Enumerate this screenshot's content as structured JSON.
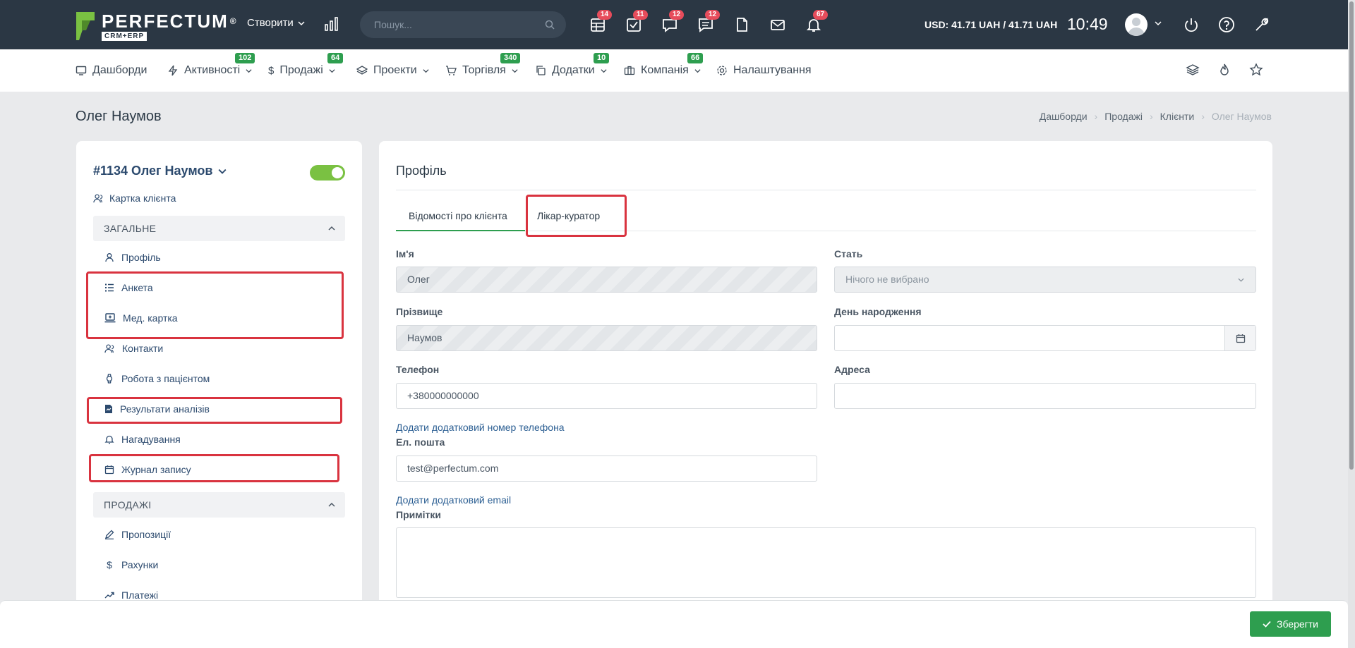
{
  "topbar": {
    "logo_name": "PERFECTUM",
    "logo_reg": "®",
    "logo_sub": "CRM+ERP",
    "create_label": "Створити",
    "search_placeholder": "Пошук...",
    "badges": {
      "calendar": "14",
      "tasks": "11",
      "chat": "12",
      "messages": "12",
      "notifications": "67"
    },
    "rate": "USD: 41.71 UAH / 41.71 UAH",
    "clock": "10:49"
  },
  "nav": {
    "items": [
      {
        "label": "Дашборди",
        "badge": ""
      },
      {
        "label": "Активності",
        "badge": "102"
      },
      {
        "label": "Продажі",
        "badge": "64"
      },
      {
        "label": "Проекти",
        "badge": ""
      },
      {
        "label": "Торгівля",
        "badge": "340"
      },
      {
        "label": "Додатки",
        "badge": "10"
      },
      {
        "label": "Компанія",
        "badge": "66"
      },
      {
        "label": "Налаштування",
        "badge": ""
      }
    ]
  },
  "page": {
    "title": "Олег Наумов",
    "breadcrumb": [
      "Дашборди",
      "Продажі",
      "Клієнти",
      "Олег Наумов"
    ]
  },
  "sidebar": {
    "client_title": "#1134 Олег Наумов",
    "client_card": "Картка клієнта",
    "section_general": "ЗАГАЛЬНЕ",
    "section_sales": "ПРОДАЖІ",
    "items": [
      "Профіль",
      "Анкета",
      "Мед. картка",
      "Контакти",
      "Робота з пацієнтом",
      "Результати аналізів",
      "Нагадування",
      "Журнал запису",
      "Пропозиції",
      "Рахунки",
      "Платежі"
    ]
  },
  "profile": {
    "title": "Профіль",
    "tabs": [
      "Відомості про клієнта",
      "Лікар-куратор"
    ],
    "labels": {
      "first_name": "Ім'я",
      "gender": "Стать",
      "last_name": "Прізвище",
      "birthday": "День народження",
      "phone": "Телефон",
      "address": "Адреса",
      "email": "Ел. пошта",
      "notes": "Примітки"
    },
    "values": {
      "first_name": "Олег",
      "gender": "Нічого не вибрано",
      "last_name": "Наумов",
      "birthday": "",
      "phone": "+380000000000",
      "address": "",
      "email": "test@perfectum.com"
    },
    "add_phone": "Додати додатковий номер телефона",
    "add_email": "Додати додатковий email"
  },
  "footer": {
    "save_label": "Зберегти"
  },
  "colors": {
    "topbar": "#2b3744",
    "accent_green": "#2e9e4f",
    "badge_red": "#e74c5b",
    "highlight_red": "#d9333f",
    "toggle_green": "#7ac142"
  }
}
